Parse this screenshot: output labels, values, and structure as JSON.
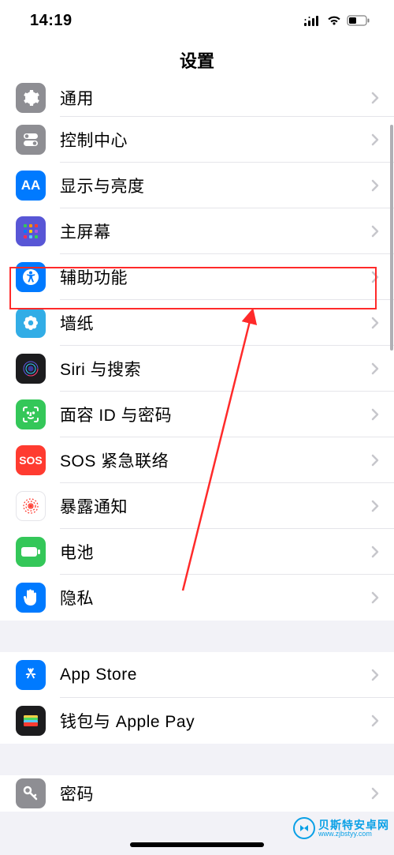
{
  "status": {
    "time": "14:19"
  },
  "nav": {
    "title": "设置"
  },
  "rows": [
    {
      "id": "general",
      "label": "通用",
      "icon": "gear-icon"
    },
    {
      "id": "control-center",
      "label": "控制中心",
      "icon": "switches-icon"
    },
    {
      "id": "display",
      "label": "显示与亮度",
      "icon": "text-size-icon"
    },
    {
      "id": "home-screen",
      "label": "主屏幕",
      "icon": "home-grid-icon"
    },
    {
      "id": "accessibility",
      "label": "辅助功能",
      "icon": "accessibility-icon"
    },
    {
      "id": "wallpaper",
      "label": "墙纸",
      "icon": "flower-icon"
    },
    {
      "id": "siri",
      "label": "Siri 与搜索",
      "icon": "siri-icon"
    },
    {
      "id": "faceid",
      "label": "面容 ID 与密码",
      "icon": "faceid-icon"
    },
    {
      "id": "sos",
      "label": "SOS 紧急联络",
      "icon": "sos-icon"
    },
    {
      "id": "exposure",
      "label": "暴露通知",
      "icon": "exposure-icon"
    },
    {
      "id": "battery",
      "label": "电池",
      "icon": "battery-icon"
    },
    {
      "id": "privacy",
      "label": "隐私",
      "icon": "hand-icon"
    }
  ],
  "rows2": [
    {
      "id": "app-store",
      "label": "App Store",
      "icon": "appstore-icon"
    },
    {
      "id": "wallet",
      "label": "钱包与 Apple Pay",
      "icon": "wallet-icon"
    }
  ],
  "rows3": [
    {
      "id": "passwords",
      "label": "密码",
      "icon": "key-icon"
    }
  ],
  "sos_text": "SOS",
  "aa_text": "AA",
  "watermark": {
    "line1": "贝斯特安卓网",
    "line2": "www.zjbstyy.com"
  }
}
